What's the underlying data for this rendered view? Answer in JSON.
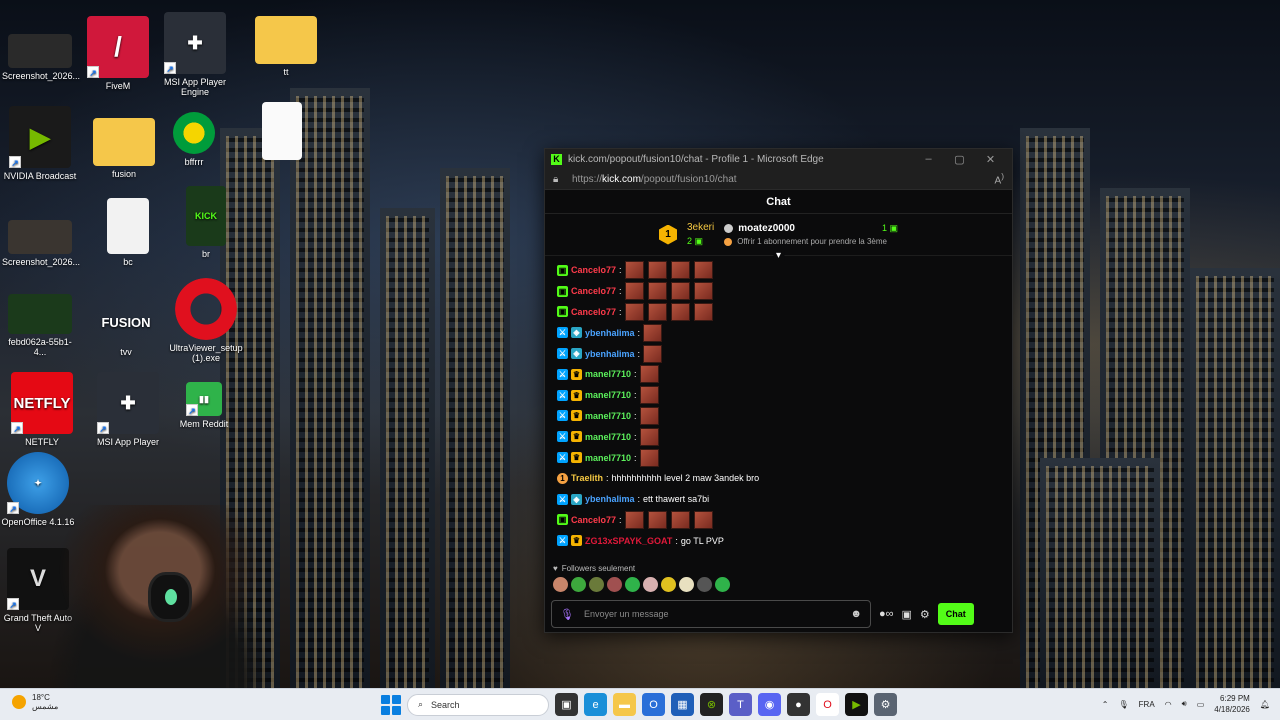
{
  "desktop": {
    "icons": [
      {
        "label": "Screenshot_2026...",
        "icon": "screenshot-thumbnail"
      },
      {
        "label": "NVIDIA Broadcast",
        "icon": "nvidia-broadcast-icon"
      },
      {
        "label": "Screenshot_2026...",
        "icon": "screenshot-thumbnail"
      },
      {
        "label": "febd062a-55b1-4...",
        "icon": "video-thumbnail"
      },
      {
        "label": "NETFLY",
        "icon": "netfly-icon"
      },
      {
        "label": "OpenOffice 4.1.16",
        "icon": "openoffice-icon"
      },
      {
        "label": "Grand Theft Auto V",
        "icon": "gta-v-icon"
      },
      {
        "label": "FiveM",
        "icon": "fivem-icon"
      },
      {
        "label": "fusion",
        "icon": "folder-icon"
      },
      {
        "label": "bc",
        "icon": "blank-file-icon"
      },
      {
        "label": "tvv",
        "icon": "fusion-tv-icon"
      },
      {
        "label": "MSI App Player",
        "icon": "msi-app-player-icon"
      },
      {
        "label": "MSI App Player Engine",
        "icon": "msi-app-player-icon"
      },
      {
        "label": "bffrrr",
        "icon": "brazil-ball-icon"
      },
      {
        "label": "br",
        "icon": "kick-thumbnail"
      },
      {
        "label": "UltraViewer_setup (1).exe",
        "icon": "opera-icon"
      },
      {
        "label": "Mem Reddit",
        "icon": "green-app-icon"
      },
      {
        "label": "tt",
        "icon": "folder-icon"
      },
      {
        "label": "",
        "icon": "document-thumbnail"
      }
    ]
  },
  "browser": {
    "window_title": "kick.com/popout/fusion10/chat - Profile 1 - Microsoft Edge",
    "url_prefix": "https://",
    "url_host": "kick.com",
    "url_path": "/popout/fusion10/chat",
    "controls": {
      "minimize": "–",
      "maximize": "▢",
      "close": "✕"
    }
  },
  "chat": {
    "header": "Chat",
    "leaderboard": {
      "rank": "1",
      "top_user": "3ekeri",
      "top_count": "2",
      "second_user": "moatez0000",
      "second_count": "1",
      "note": "Offrir 1 abonnement pour prendre la 3ème"
    },
    "messages": [
      {
        "badges": [
          "sub"
        ],
        "user": "Cancelo77",
        "color": "#ff3b4b",
        "text": "",
        "emotes": 4
      },
      {
        "badges": [
          "sub"
        ],
        "user": "Cancelo77",
        "color": "#ff3b4b",
        "text": "",
        "emotes": 4
      },
      {
        "badges": [
          "sub"
        ],
        "user": "Cancelo77",
        "color": "#ff3b4b",
        "text": "",
        "emotes": 4
      },
      {
        "badges": [
          "mod",
          "og"
        ],
        "user": "ybenhalima",
        "color": "#4aa3ff",
        "text": "",
        "emotes": 1
      },
      {
        "badges": [
          "mod",
          "og"
        ],
        "user": "ybenhalima",
        "color": "#4aa3ff",
        "text": "",
        "emotes": 1
      },
      {
        "badges": [
          "mod",
          "crown"
        ],
        "user": "manel7710",
        "color": "#5cf05c",
        "text": "",
        "emotes": 1
      },
      {
        "badges": [
          "mod",
          "crown"
        ],
        "user": "manel7710",
        "color": "#5cf05c",
        "text": "",
        "emotes": 1
      },
      {
        "badges": [
          "mod",
          "crown"
        ],
        "user": "manel7710",
        "color": "#5cf05c",
        "text": "",
        "emotes": 1
      },
      {
        "badges": [
          "mod",
          "crown"
        ],
        "user": "manel7710",
        "color": "#5cf05c",
        "text": "",
        "emotes": 1
      },
      {
        "badges": [
          "mod",
          "crown"
        ],
        "user": "manel7710",
        "color": "#5cf05c",
        "text": "",
        "emotes": 1
      },
      {
        "badges": [
          "gift"
        ],
        "user": "Traelith",
        "color": "#f5c842",
        "text": "hhhhhhhhhh level 2 maw 3andek bro",
        "emotes": 0
      },
      {
        "badges": [
          "mod",
          "og"
        ],
        "user": "ybenhalima",
        "color": "#4aa3ff",
        "text": "ett thawert sa7bi",
        "emotes": 0
      },
      {
        "badges": [
          "sub"
        ],
        "user": "Cancelo77",
        "color": "#ff3b4b",
        "text": "",
        "emotes": 4
      },
      {
        "badges": [
          "mod",
          "crown"
        ],
        "user": "ZG13xSPAYK_GOAT",
        "color": "#e0193a",
        "text": "go TL PVP",
        "emotes": 0
      }
    ],
    "followers_only": "Followers seulement",
    "input_placeholder": "Envoyer un message",
    "send_label": "Chat"
  },
  "taskbar": {
    "weather_temp": "18°C",
    "weather_desc": "مشمس",
    "search_placeholder": "Search",
    "language": "FRA",
    "time": "6:29 PM",
    "date": "4/18/2026"
  },
  "colors": {
    "kick_green": "#53fc18",
    "taskbar_bg": "#e8ecf2"
  }
}
